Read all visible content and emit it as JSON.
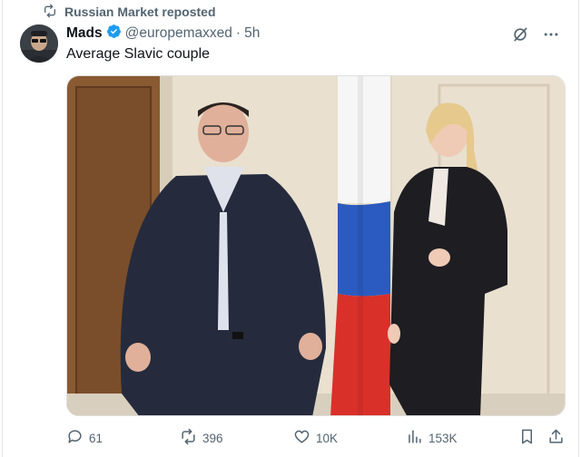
{
  "repost": {
    "label": "Russian Market reposted",
    "icon": "repost-icon"
  },
  "author": {
    "name": "Mads",
    "handle": "@europemaxxed",
    "separator": "·",
    "time": "5h",
    "verified_color": "#1d9bf0"
  },
  "tweet": {
    "text": "Average Slavic couple"
  },
  "header_icons": [
    "grok-icon",
    "more-icon"
  ],
  "actions": {
    "replies": "61",
    "reposts": "396",
    "likes": "10K",
    "views": "153K"
  },
  "colors": {
    "secondary_text": "#536471",
    "primary_text": "#0f1419",
    "accent": "#1d9bf0"
  }
}
